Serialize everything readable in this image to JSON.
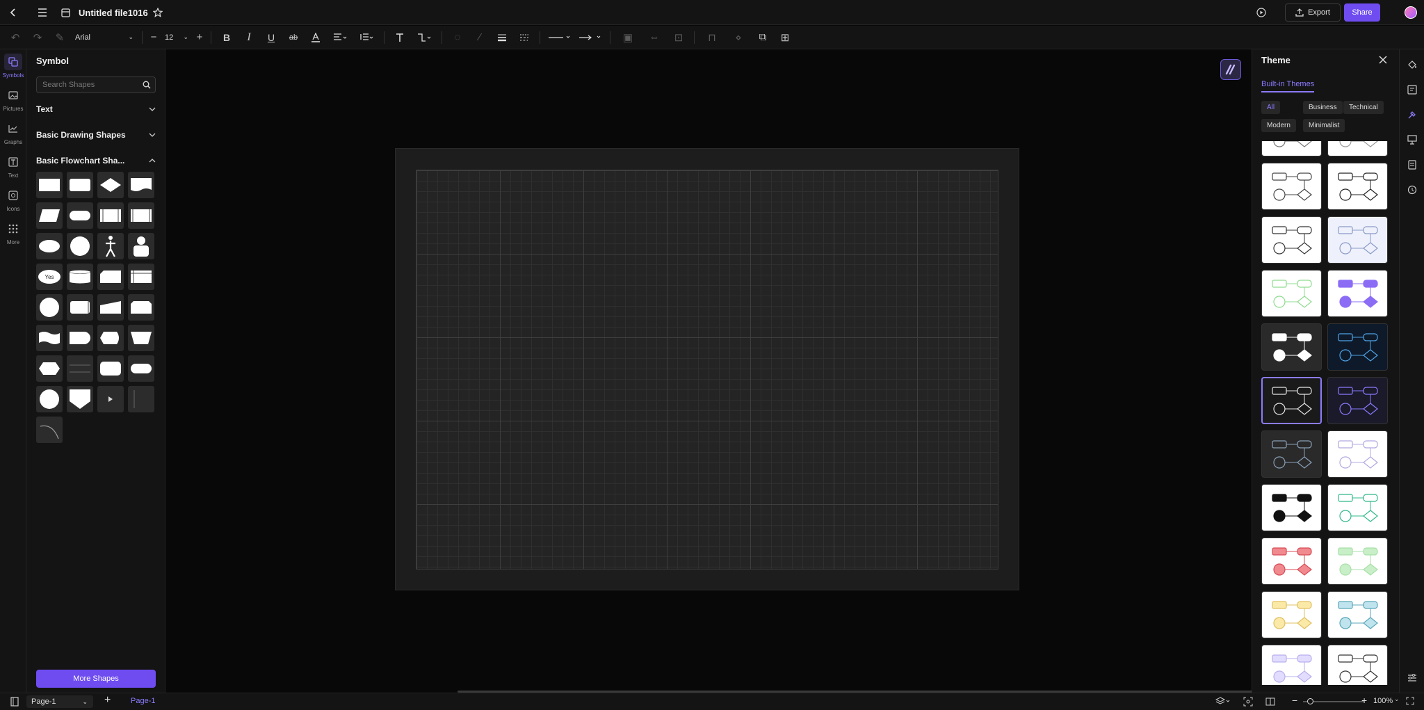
{
  "header": {
    "file_title": "Untitled file1016",
    "export_label": "Export",
    "share_label": "Share"
  },
  "toolbar": {
    "font_family": "Arial",
    "font_size": "12",
    "bold_glyph": "B",
    "italic_glyph": "I",
    "underline_glyph": "U",
    "strike_glyph": "ab"
  },
  "rail": {
    "items": [
      {
        "label": "Symbols",
        "icon": "symbols-icon"
      },
      {
        "label": "Pictures",
        "icon": "picture-icon"
      },
      {
        "label": "Graphs",
        "icon": "graph-icon"
      },
      {
        "label": "Text",
        "icon": "text-icon"
      },
      {
        "label": "Icons",
        "icon": "icons-icon"
      },
      {
        "label": "More",
        "icon": "grid-icon"
      }
    ]
  },
  "library": {
    "title": "Symbol",
    "search_placeholder": "Search Shapes",
    "categories": [
      "Text",
      "Basic Drawing Shapes",
      "Basic Flowchart Sha..."
    ],
    "yes_label": "Yes",
    "more_shapes_label": "More Shapes"
  },
  "theme_panel": {
    "title": "Theme",
    "tab": "Built-in Themes",
    "filters": [
      "All",
      "Business",
      "Technical",
      "Modern",
      "Minimalist"
    ],
    "active_filter": "All"
  },
  "status": {
    "page_select": "Page-1",
    "page_tab": "Page-1",
    "zoom": "100%"
  },
  "colors": {
    "accent": "#6e4cf0",
    "accent_text": "#8b7bff",
    "bg": "#141414"
  }
}
